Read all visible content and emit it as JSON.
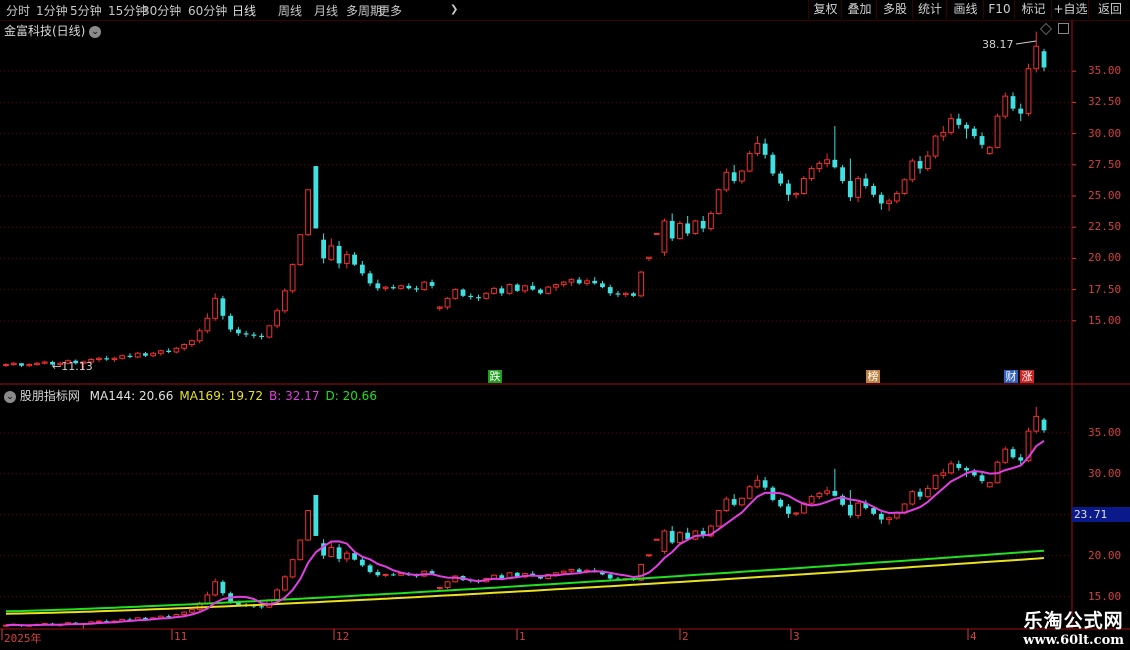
{
  "toolbar": {
    "periods": [
      "分时",
      "1分钟",
      "5分钟",
      "15分钟",
      "30分钟",
      "60分钟",
      "日线",
      "周线",
      "月线",
      "多周期",
      "更多"
    ],
    "active_period": "日线",
    "more_arrow": "❯",
    "right_buttons": [
      "复权",
      "叠加",
      "多股",
      "统计",
      "画线",
      "F10",
      "标记",
      "+自选",
      "返回"
    ]
  },
  "main_panel": {
    "title": "金富科技(日线)",
    "title_icon": "chevron-down-icon",
    "high_label": "38.17",
    "low_label": "11.13",
    "y_ticks": [
      "35.00",
      "32.50",
      "30.00",
      "27.50",
      "25.00",
      "22.50",
      "20.00",
      "17.50",
      "15.00"
    ],
    "markers": [
      {
        "text": "跌",
        "color": "#20a020"
      },
      {
        "text": "榜",
        "color": "#c08040"
      },
      {
        "text": "财",
        "color": "#3060c0"
      },
      {
        "text": "涨",
        "color": "#d02020"
      }
    ]
  },
  "indicator_panel": {
    "title": "股朋指标网",
    "values": [
      {
        "label": "MA144: 20.66",
        "color": "#e0e0e0"
      },
      {
        "label": "MA169: 19.72",
        "color": "#e8e020"
      },
      {
        "label": "B: 32.17",
        "color": "#e040e0"
      },
      {
        "label": "D: 20.66",
        "color": "#20e020"
      }
    ],
    "y_ticks": [
      "35.00",
      "30.00",
      "25.00",
      "20.00",
      "15.00"
    ],
    "current_value": "23.71"
  },
  "x_axis": {
    "labels": [
      "2025年",
      "11",
      "12",
      "1",
      "2",
      "3",
      "4"
    ]
  },
  "watermark": {
    "title": "乐淘公式网",
    "url": "www.60lt.com"
  },
  "colors": {
    "up": "#f03030",
    "down": "#40e0e0",
    "grid": "#6a0000",
    "axis": "#d24040",
    "ma144": "#e0e0e0",
    "ma169": "#e8e020",
    "b_line": "#e040e0",
    "d_line": "#20e020"
  },
  "chart_data": {
    "type": "candlestick",
    "ylim": [
      12.5,
      37.5
    ],
    "candles": [
      [
        11.5,
        11.6,
        11.3,
        11.5
      ],
      [
        11.5,
        11.7,
        11.4,
        11.6
      ],
      [
        11.6,
        11.6,
        11.3,
        11.4
      ],
      [
        11.4,
        11.6,
        11.3,
        11.5
      ],
      [
        11.5,
        11.7,
        11.4,
        11.6
      ],
      [
        11.6,
        11.8,
        11.5,
        11.7
      ],
      [
        11.7,
        11.8,
        11.4,
        11.5
      ],
      [
        11.5,
        11.7,
        11.3,
        11.6
      ],
      [
        11.6,
        11.9,
        11.5,
        11.8
      ],
      [
        11.8,
        11.9,
        11.5,
        11.6
      ],
      [
        11.6,
        11.8,
        11.1,
        11.7
      ],
      [
        11.7,
        12.0,
        11.6,
        11.9
      ],
      [
        11.9,
        12.1,
        11.7,
        12.0
      ],
      [
        12.0,
        12.2,
        11.8,
        11.9
      ],
      [
        11.9,
        12.1,
        11.7,
        12.0
      ],
      [
        12.0,
        12.3,
        11.9,
        12.2
      ],
      [
        12.2,
        12.4,
        12.0,
        12.1
      ],
      [
        12.1,
        12.5,
        12.0,
        12.4
      ],
      [
        12.4,
        12.5,
        12.1,
        12.2
      ],
      [
        12.2,
        12.5,
        12.1,
        12.4
      ],
      [
        12.4,
        12.7,
        12.2,
        12.6
      ],
      [
        12.6,
        12.8,
        12.4,
        12.5
      ],
      [
        12.5,
        12.9,
        12.4,
        12.8
      ],
      [
        12.8,
        13.2,
        12.6,
        13.1
      ],
      [
        13.1,
        13.5,
        12.9,
        13.4
      ],
      [
        13.4,
        14.4,
        13.2,
        14.2
      ],
      [
        14.2,
        15.6,
        14.0,
        15.2
      ],
      [
        15.2,
        17.2,
        15.0,
        16.8
      ],
      [
        16.8,
        17.0,
        15.1,
        15.4
      ],
      [
        15.4,
        15.6,
        14.1,
        14.3
      ],
      [
        14.3,
        14.5,
        13.8,
        14.0
      ],
      [
        14.0,
        14.2,
        13.7,
        13.9
      ],
      [
        13.9,
        14.1,
        13.6,
        13.8
      ],
      [
        13.8,
        14.0,
        13.5,
        13.7
      ],
      [
        13.7,
        14.6,
        13.6,
        14.6
      ],
      [
        14.6,
        16.0,
        14.4,
        15.8
      ],
      [
        15.8,
        17.6,
        15.6,
        17.4
      ],
      [
        17.4,
        19.6,
        17.2,
        19.5
      ],
      [
        19.5,
        21.9,
        19.4,
        21.9
      ],
      [
        21.9,
        25.5,
        21.8,
        25.5
      ],
      [
        27.4,
        27.4,
        22.4,
        22.4
      ],
      [
        21.5,
        22.0,
        19.6,
        20.0
      ],
      [
        19.9,
        21.6,
        19.8,
        21.0
      ],
      [
        21.0,
        21.4,
        19.2,
        19.6
      ],
      [
        19.6,
        20.6,
        19.2,
        20.3
      ],
      [
        20.3,
        20.5,
        19.4,
        19.5
      ],
      [
        19.5,
        19.8,
        18.6,
        18.8
      ],
      [
        18.8,
        19.0,
        17.8,
        18.0
      ],
      [
        18.0,
        18.3,
        17.4,
        17.6
      ],
      [
        17.6,
        17.8,
        17.4,
        17.7
      ],
      [
        17.7,
        17.9,
        17.5,
        17.6
      ],
      [
        17.6,
        17.9,
        17.5,
        17.8
      ],
      [
        17.8,
        18.0,
        17.5,
        17.6
      ],
      [
        17.6,
        17.8,
        17.3,
        17.5
      ],
      [
        17.5,
        18.2,
        17.4,
        18.1
      ],
      [
        18.1,
        18.3,
        17.6,
        17.8
      ],
      [
        16.0,
        16.2,
        15.8,
        16.1
      ],
      [
        16.1,
        16.9,
        15.9,
        16.8
      ],
      [
        16.8,
        17.6,
        16.7,
        17.5
      ],
      [
        17.5,
        17.6,
        16.9,
        17.0
      ],
      [
        17.0,
        17.2,
        16.7,
        16.9
      ],
      [
        16.9,
        17.1,
        16.6,
        16.8
      ],
      [
        16.8,
        17.3,
        16.7,
        17.2
      ],
      [
        17.2,
        17.7,
        17.1,
        17.6
      ],
      [
        17.6,
        17.8,
        17.0,
        17.2
      ],
      [
        17.2,
        18.0,
        17.1,
        17.9
      ],
      [
        17.9,
        18.0,
        17.3,
        17.4
      ],
      [
        17.4,
        17.9,
        17.2,
        17.8
      ],
      [
        17.8,
        18.1,
        17.4,
        17.5
      ],
      [
        17.5,
        17.6,
        17.1,
        17.2
      ],
      [
        17.2,
        17.8,
        17.1,
        17.7
      ],
      [
        17.7,
        18.0,
        17.4,
        17.9
      ],
      [
        17.9,
        18.2,
        17.7,
        18.1
      ],
      [
        18.1,
        18.4,
        17.8,
        18.3
      ],
      [
        18.3,
        18.5,
        17.9,
        18.0
      ],
      [
        18.0,
        18.4,
        17.8,
        18.2
      ],
      [
        18.2,
        18.5,
        17.9,
        18.0
      ],
      [
        18.0,
        18.2,
        17.6,
        17.7
      ],
      [
        17.7,
        17.9,
        17.0,
        17.2
      ],
      [
        17.2,
        17.4,
        16.9,
        17.1
      ],
      [
        17.1,
        17.3,
        16.9,
        17.2
      ],
      [
        17.2,
        17.3,
        16.9,
        17.0
      ],
      [
        17.0,
        19.0,
        16.9,
        18.9
      ],
      [
        20.0,
        20.0,
        19.8,
        20.1
      ],
      [
        22.0,
        22.0,
        21.9,
        22.0
      ],
      [
        20.5,
        23.2,
        20.2,
        23.0
      ],
      [
        23.0,
        23.6,
        21.4,
        21.6
      ],
      [
        21.6,
        23.0,
        21.5,
        22.8
      ],
      [
        22.8,
        23.4,
        21.8,
        22.0
      ],
      [
        22.0,
        23.1,
        21.9,
        23.0
      ],
      [
        23.0,
        23.4,
        22.1,
        22.4
      ],
      [
        22.4,
        23.8,
        22.2,
        23.6
      ],
      [
        23.6,
        25.6,
        23.5,
        25.5
      ],
      [
        25.5,
        27.2,
        25.3,
        26.9
      ],
      [
        26.9,
        27.5,
        26.0,
        26.2
      ],
      [
        26.2,
        27.1,
        26.0,
        27.0
      ],
      [
        27.0,
        28.6,
        26.9,
        28.4
      ],
      [
        28.4,
        29.8,
        28.2,
        29.2
      ],
      [
        29.2,
        29.6,
        28.0,
        28.3
      ],
      [
        28.3,
        28.5,
        26.6,
        26.8
      ],
      [
        26.8,
        27.0,
        25.8,
        26.0
      ],
      [
        26.0,
        26.3,
        24.6,
        25.1
      ],
      [
        25.1,
        25.3,
        24.8,
        25.2
      ],
      [
        25.2,
        26.6,
        25.1,
        26.4
      ],
      [
        26.4,
        27.4,
        26.2,
        27.2
      ],
      [
        27.2,
        27.8,
        26.9,
        27.6
      ],
      [
        27.6,
        28.4,
        27.3,
        27.9
      ],
      [
        27.9,
        30.6,
        27.2,
        27.3
      ],
      [
        27.3,
        27.5,
        26.0,
        26.2
      ],
      [
        26.2,
        28.0,
        24.6,
        24.9
      ],
      [
        24.9,
        26.6,
        24.5,
        26.4
      ],
      [
        26.4,
        26.8,
        25.6,
        25.8
      ],
      [
        25.8,
        26.0,
        24.9,
        25.1
      ],
      [
        25.1,
        25.3,
        23.9,
        24.4
      ],
      [
        24.4,
        24.8,
        23.8,
        24.6
      ],
      [
        24.6,
        25.4,
        24.4,
        25.2
      ],
      [
        25.2,
        26.4,
        25.1,
        26.3
      ],
      [
        26.3,
        28.0,
        26.1,
        27.8
      ],
      [
        27.8,
        28.2,
        26.8,
        27.2
      ],
      [
        27.2,
        28.6,
        27.0,
        28.2
      ],
      [
        28.2,
        29.9,
        28.0,
        29.8
      ],
      [
        29.8,
        30.6,
        29.4,
        30.1
      ],
      [
        30.1,
        31.6,
        29.9,
        31.2
      ],
      [
        31.2,
        31.6,
        30.4,
        30.7
      ],
      [
        30.7,
        30.9,
        29.6,
        30.4
      ],
      [
        30.4,
        30.6,
        29.6,
        29.8
      ],
      [
        29.8,
        30.1,
        28.8,
        29.1
      ],
      [
        28.4,
        29.0,
        28.3,
        28.9
      ],
      [
        28.9,
        31.6,
        28.8,
        31.4
      ],
      [
        31.4,
        33.3,
        31.2,
        33.0
      ],
      [
        33.0,
        33.3,
        31.8,
        32.0
      ],
      [
        32.0,
        32.4,
        31.0,
        31.6
      ],
      [
        31.6,
        35.6,
        31.4,
        35.2
      ],
      [
        35.2,
        38.17,
        34.9,
        37.0
      ],
      [
        36.6,
        36.8,
        35.0,
        35.3
      ]
    ],
    "annotations": [
      "38.17",
      "11.13"
    ]
  }
}
